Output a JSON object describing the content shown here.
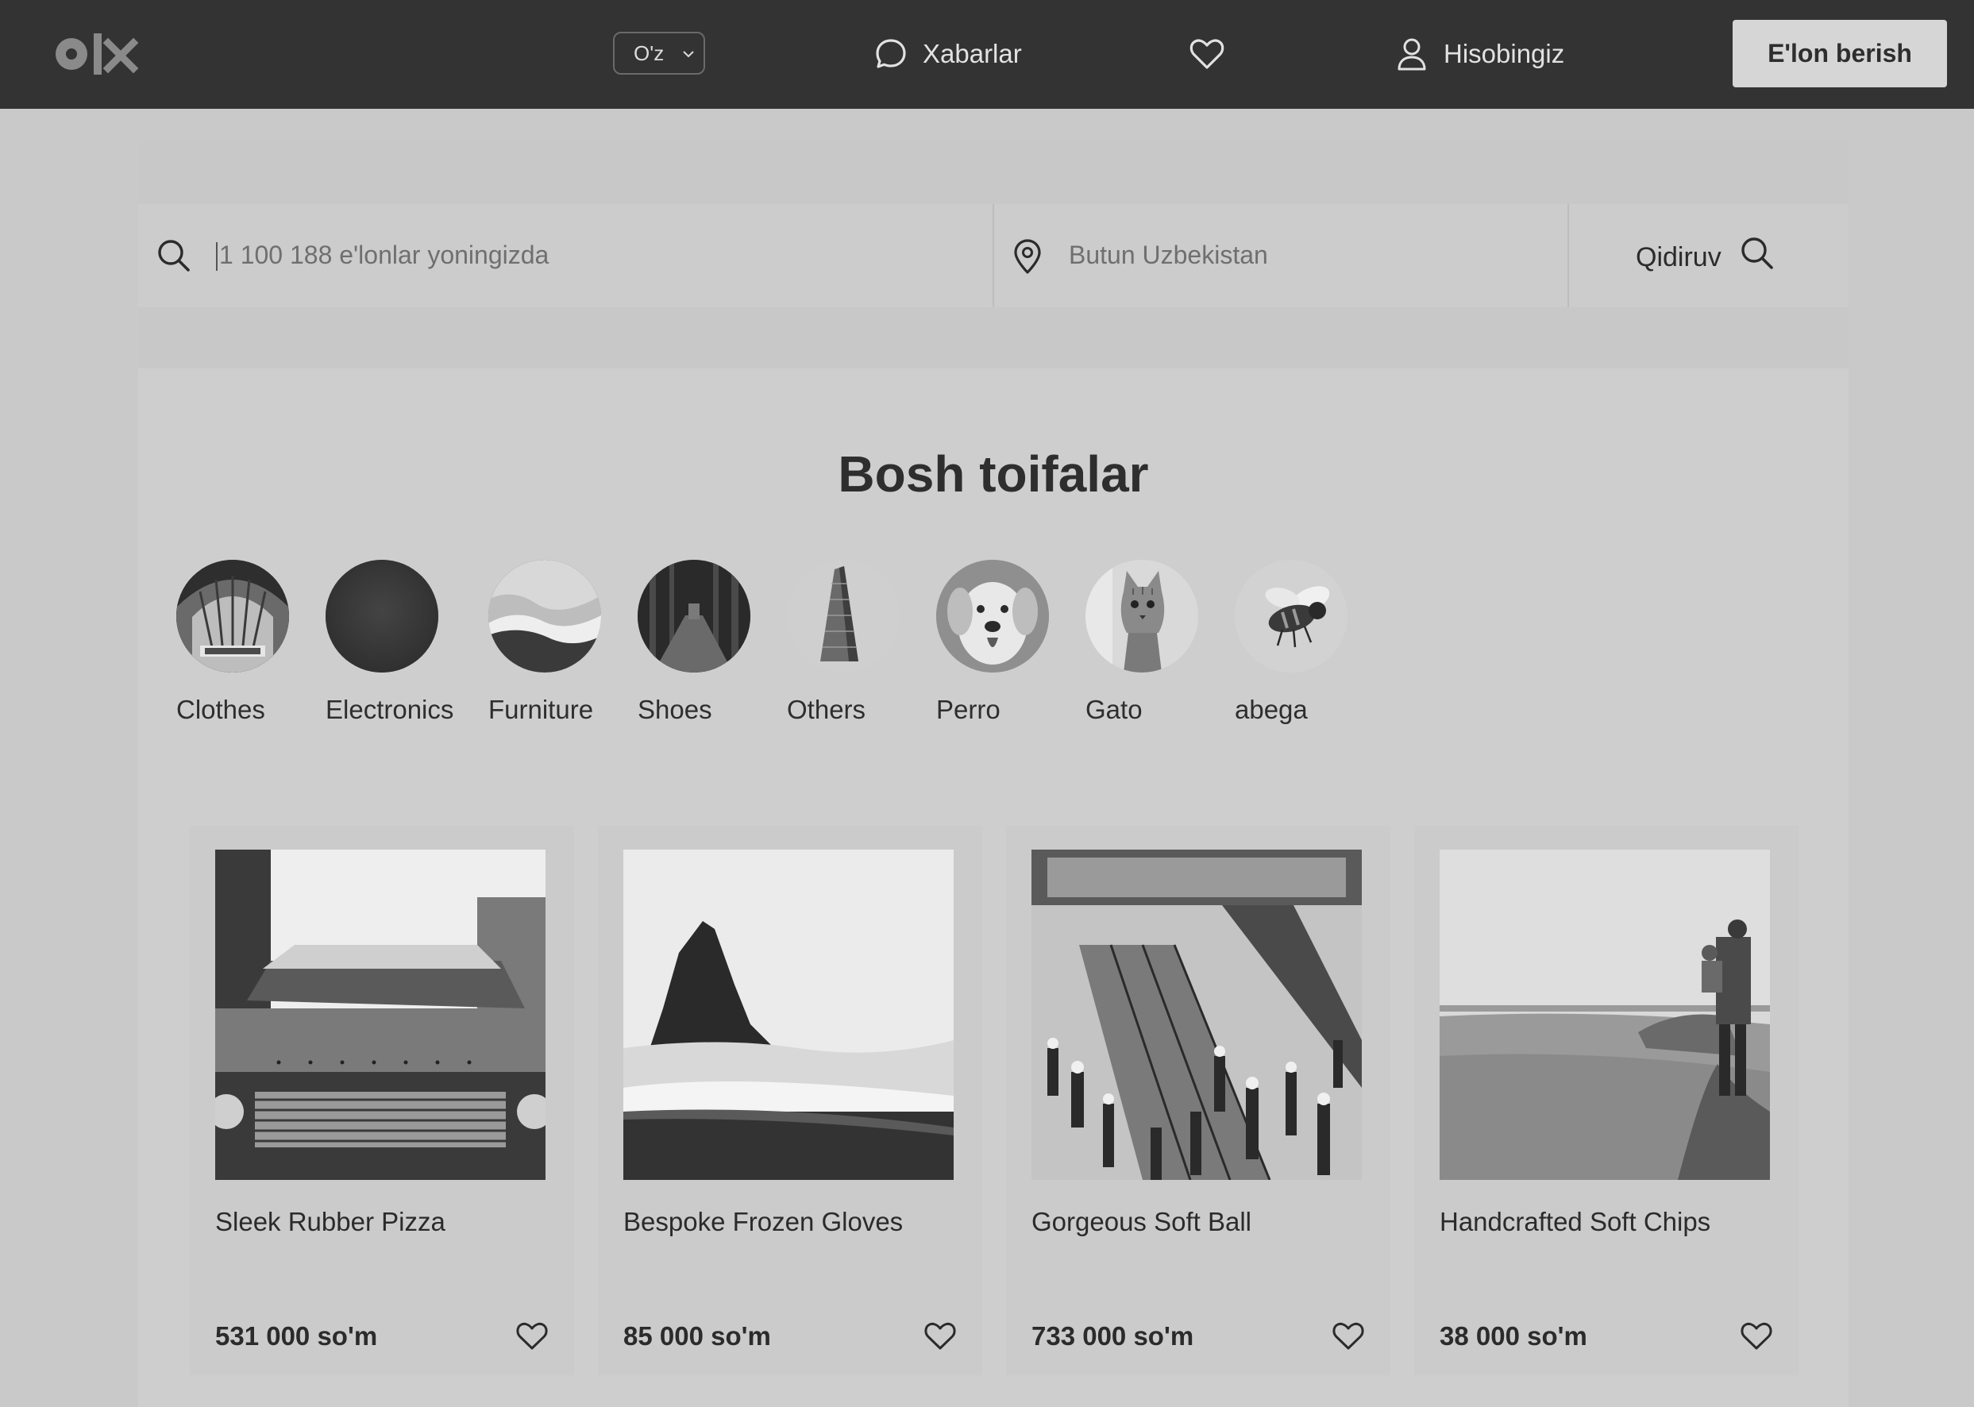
{
  "header": {
    "logo_text": "olx",
    "language": "O'z",
    "messages_label": "Xabarlar",
    "account_label": "Hisobingiz",
    "post_button_label": "E'lon berish"
  },
  "search": {
    "query_placeholder": "1 100 188 e'lonlar yoningizda",
    "location_placeholder": "Butun Uzbekistan",
    "submit_label": "Qidiruv"
  },
  "categories": {
    "title": "Bosh toifalar",
    "items": [
      {
        "label": "Clothes",
        "image": "arched-ceiling-photo"
      },
      {
        "label": "Electronics",
        "image": "dark-photo"
      },
      {
        "label": "Furniture",
        "image": "ocean-wave-photo"
      },
      {
        "label": "Shoes",
        "image": "forest-path-photo"
      },
      {
        "label": "Others",
        "image": "flatiron-building-photo"
      },
      {
        "label": "Perro",
        "image": "dog-photo"
      },
      {
        "label": "Gato",
        "image": "cat-photo"
      },
      {
        "label": "abega",
        "image": "bee-photo"
      }
    ]
  },
  "products": [
    {
      "title": "Sleek Rubber Pizza",
      "price": "531 000 so'm",
      "image": "vintage-car-photo"
    },
    {
      "title": "Bespoke Frozen Gloves",
      "price": "85 000 so'm",
      "image": "sea-stack-photo"
    },
    {
      "title": "Gorgeous Soft Ball",
      "price": "733 000 so'm",
      "image": "crowd-escalator-photo"
    },
    {
      "title": "Handcrafted Soft Chips",
      "price": "38 000 so'm",
      "image": "beach-father-child-photo"
    }
  ],
  "colors": {
    "topbar": "#333333",
    "page_background": "#c9c9c9",
    "post_button": "#d6d6d6",
    "text": "#2b2b2b"
  }
}
